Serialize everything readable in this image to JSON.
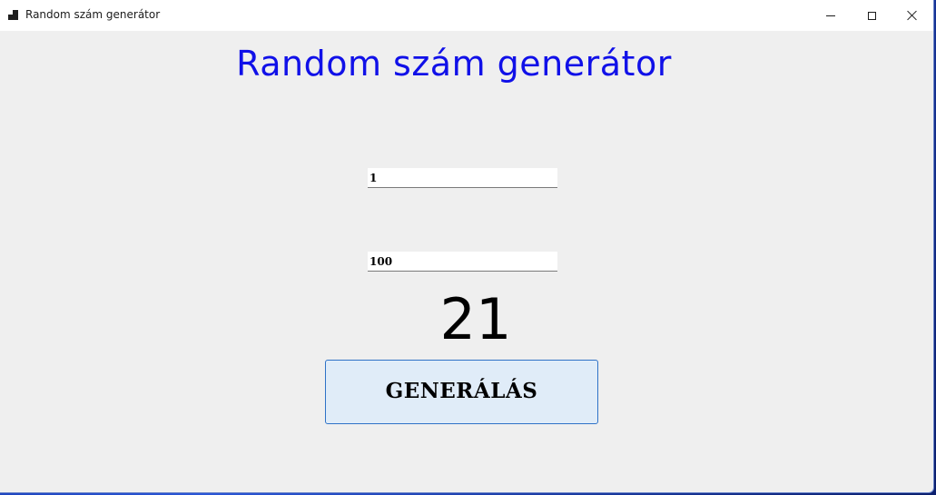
{
  "window": {
    "title": "Random szám generátor",
    "icon": "app-window-icon",
    "controls": {
      "minimize_icon": "minimize-icon",
      "maximize_icon": "maximize-icon",
      "close_icon": "close-icon"
    }
  },
  "main": {
    "heading": "Random szám generátor",
    "heading_color": "#1010e8",
    "min_value": "1",
    "max_value": "100",
    "result": "21",
    "generate_label": "GENERÁLÁS"
  },
  "colors": {
    "window_bg": "#efefef",
    "button_bg": "#e0ecf8",
    "button_border": "#2f72c7"
  }
}
